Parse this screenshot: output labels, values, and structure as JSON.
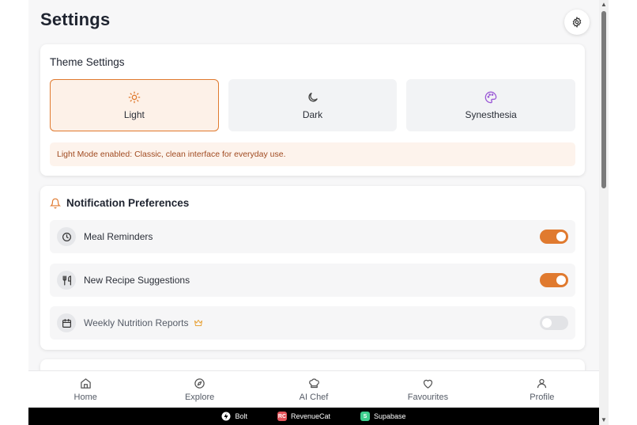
{
  "page": {
    "title": "Settings"
  },
  "theme": {
    "heading": "Theme Settings",
    "options": [
      {
        "label": "Light",
        "icon": "sun-icon",
        "selected": true
      },
      {
        "label": "Dark",
        "icon": "moon-icon",
        "selected": false
      },
      {
        "label": "Synesthesia",
        "icon": "palette-icon",
        "selected": false
      }
    ],
    "note": "Light Mode enabled: Classic, clean interface for everyday use."
  },
  "notifications": {
    "heading": "Notification Preferences",
    "items": [
      {
        "label": "Meal Reminders",
        "icon": "clock-icon",
        "enabled": true
      },
      {
        "label": "New Recipe Suggestions",
        "icon": "utensils-icon",
        "enabled": true
      },
      {
        "label": "Weekly Nutrition Reports",
        "icon": "calendar-icon",
        "enabled": false,
        "premium_icon": "crown-icon"
      }
    ]
  },
  "nav": {
    "items": [
      {
        "label": "Home",
        "icon": "home-icon"
      },
      {
        "label": "Explore",
        "icon": "compass-icon"
      },
      {
        "label": "AI Chef",
        "icon": "chef-hat-icon"
      },
      {
        "label": "Favourites",
        "icon": "heart-icon"
      },
      {
        "label": "Profile",
        "icon": "user-icon"
      }
    ]
  },
  "footer": {
    "items": [
      {
        "label": "Bolt",
        "icon": "bolt-icon"
      },
      {
        "label": "RevenueCat",
        "icon": "revenuecat-icon",
        "badge": "RC"
      },
      {
        "label": "Supabase",
        "icon": "supabase-icon",
        "badge": "S"
      }
    ]
  },
  "colors": {
    "accent": "#e07a2f",
    "note_bg": "#fdf3ec",
    "synesthesia": "#9b59d6"
  }
}
